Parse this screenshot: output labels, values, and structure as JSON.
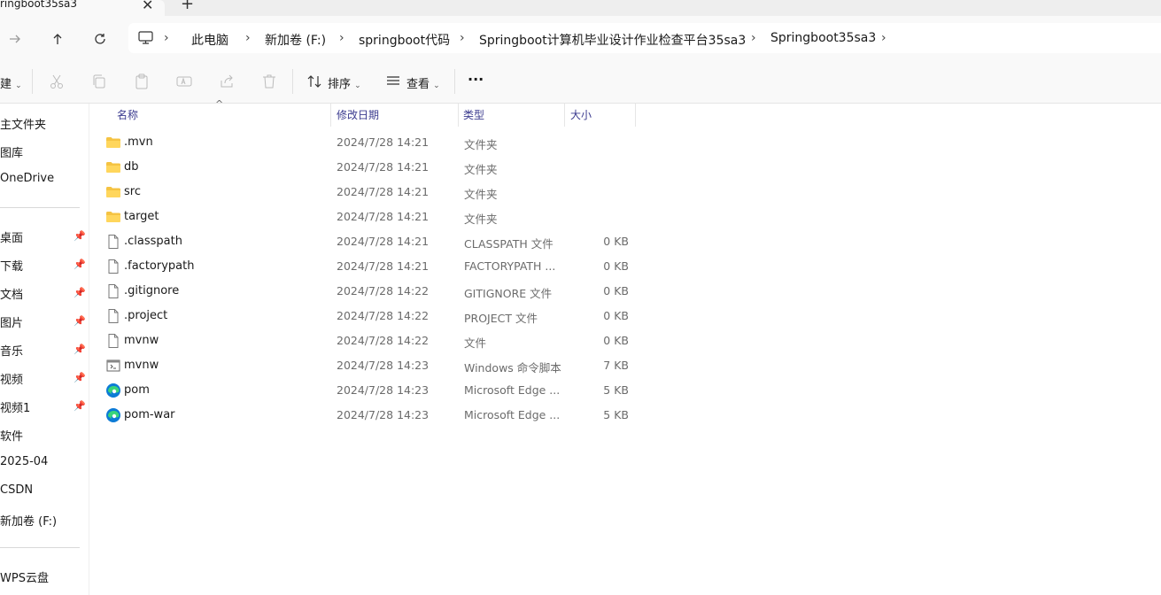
{
  "tab": {
    "title": "ringboot35sa3"
  },
  "breadcrumbs": [
    "此电脑",
    "新加卷 (F:)",
    "springboot代码",
    "Springboot计算机毕业设计作业检查平台35sa3",
    "Springboot35sa3"
  ],
  "toolbar": {
    "new_label": "建",
    "sort_label": "排序",
    "view_label": "查看",
    "more_label": "···"
  },
  "sidebar": {
    "top": [
      "主文件夹",
      "图库",
      "OneDrive"
    ],
    "pinned": [
      "桌面",
      "下载",
      "文档",
      "图片",
      "音乐",
      "视频",
      "视频1"
    ],
    "others": [
      "软件",
      "2025-04",
      "CSDN",
      "新加卷 (F:)"
    ],
    "bottom": [
      "WPS云盘"
    ]
  },
  "columns": {
    "name": "名称",
    "date": "修改日期",
    "type": "类型",
    "size": "大小"
  },
  "files": [
    {
      "name": ".mvn",
      "date": "2024/7/28 14:21",
      "type": "文件夹",
      "size": "",
      "icon": "folder-icon"
    },
    {
      "name": "db",
      "date": "2024/7/28 14:21",
      "type": "文件夹",
      "size": "",
      "icon": "folder-icon"
    },
    {
      "name": "src",
      "date": "2024/7/28 14:21",
      "type": "文件夹",
      "size": "",
      "icon": "folder-icon"
    },
    {
      "name": "target",
      "date": "2024/7/28 14:21",
      "type": "文件夹",
      "size": "",
      "icon": "folder-icon"
    },
    {
      "name": ".classpath",
      "date": "2024/7/28 14:21",
      "type": "CLASSPATH 文件",
      "size": "0 KB",
      "icon": "file-icon"
    },
    {
      "name": ".factorypath",
      "date": "2024/7/28 14:21",
      "type": "FACTORYPATH ...",
      "size": "0 KB",
      "icon": "file-icon"
    },
    {
      "name": ".gitignore",
      "date": "2024/7/28 14:22",
      "type": "GITIGNORE 文件",
      "size": "0 KB",
      "icon": "file-icon"
    },
    {
      "name": ".project",
      "date": "2024/7/28 14:22",
      "type": "PROJECT 文件",
      "size": "0 KB",
      "icon": "file-icon"
    },
    {
      "name": "mvnw",
      "date": "2024/7/28 14:22",
      "type": "文件",
      "size": "0 KB",
      "icon": "file-icon"
    },
    {
      "name": "mvnw",
      "date": "2024/7/28 14:23",
      "type": "Windows 命令脚本",
      "size": "7 KB",
      "icon": "script-icon"
    },
    {
      "name": "pom",
      "date": "2024/7/28 14:23",
      "type": "Microsoft Edge ...",
      "size": "5 KB",
      "icon": "edge-icon"
    },
    {
      "name": "pom-war",
      "date": "2024/7/28 14:23",
      "type": "Microsoft Edge ...",
      "size": "5 KB",
      "icon": "edge-icon"
    }
  ]
}
